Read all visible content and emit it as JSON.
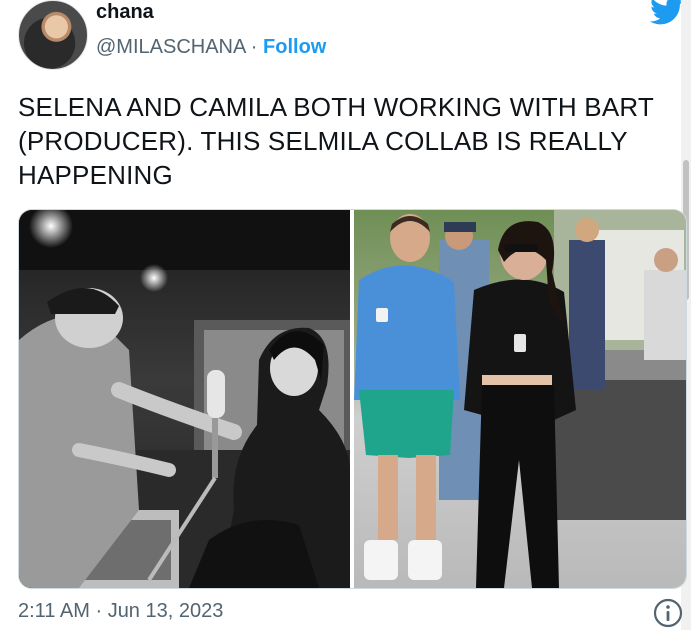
{
  "author": {
    "name": "chana",
    "handle": "@MILASCHANA",
    "separator": " · ",
    "follow_label": "Follow"
  },
  "tweet": {
    "text": "SELENA AND CAMILA BOTH WORKING WITH BART (PRODUCER). THIS SELMILA COLLAB IS REALLY HAPPENING",
    "time": "2:11 AM",
    "date_separator": " · ",
    "date": "Jun 13, 2023"
  },
  "icons": {
    "brand": "twitter-bird-icon",
    "info": "info-icon"
  },
  "colors": {
    "brand_blue": "#1d9bf0",
    "text_primary": "#0f1419",
    "text_secondary": "#536471"
  }
}
